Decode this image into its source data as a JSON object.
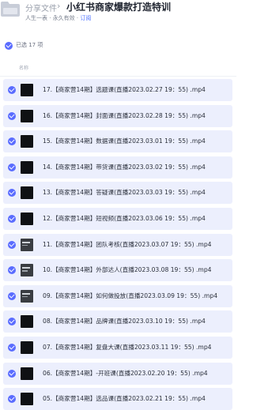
{
  "app": {
    "name": "分享文件",
    "separator": "›"
  },
  "share": {
    "title": "小红书商家爆款打造特训",
    "owner": "人生一表",
    "validity": "永久有效",
    "action": "订阅",
    "meta_sep": " · "
  },
  "selection": {
    "label": "已选 17 项"
  },
  "table": {
    "column_name": "名称"
  },
  "files": [
    {
      "name": "17.【商家营14期】选题课(直播2023.02.27 19：55) .mp4",
      "thumb": "dark"
    },
    {
      "name": "16.【商家营14期】封面课(直播2023.02.28 19：55) .mp4",
      "thumb": "dark"
    },
    {
      "name": "15.【商家营14期】数据课(直播2023.03.01 19：55) .mp4",
      "thumb": "dark"
    },
    {
      "name": "14.【商家营14期】带货课(直播2023.03.02 19：55) .mp4",
      "thumb": "dark"
    },
    {
      "name": "13.【商家营14期】答疑课(直播2023.03.03 19：55) .mp4",
      "thumb": "dark"
    },
    {
      "name": "12.【商家营14期】短视频(直播2023.03.06 19：55) .mp4",
      "thumb": "dark"
    },
    {
      "name": "11.【商家营14期】团队考核(直播2023.03.07 19：55) .mp4",
      "thumb": "grey"
    },
    {
      "name": "10.【商家营14期】外部达人(直播2023.03.08 19：55) .mp4",
      "thumb": "grey"
    },
    {
      "name": "09.【商家营14期】如何做投放(直播2023.03.09 19：55) .mp4",
      "thumb": "grey"
    },
    {
      "name": "08.【商家营14期】品牌课(直播2023.03.10 19：55) .mp4",
      "thumb": "dark"
    },
    {
      "name": "07.【商家营14期】复盘大课(直播2023.03.11 19：55) .mp4",
      "thumb": "dark"
    },
    {
      "name": "06.【商家营14期】-开班课(直播2023.02.20 19：55) .mp4",
      "thumb": "dark"
    },
    {
      "name": "05.【商家营14期】选品课(直播2023.02.21 19：55) .mp4",
      "thumb": "dark"
    }
  ],
  "colors": {
    "accent": "#5a6cff",
    "row_selected_bg": "#eceffd",
    "link": "#4c71ff"
  }
}
